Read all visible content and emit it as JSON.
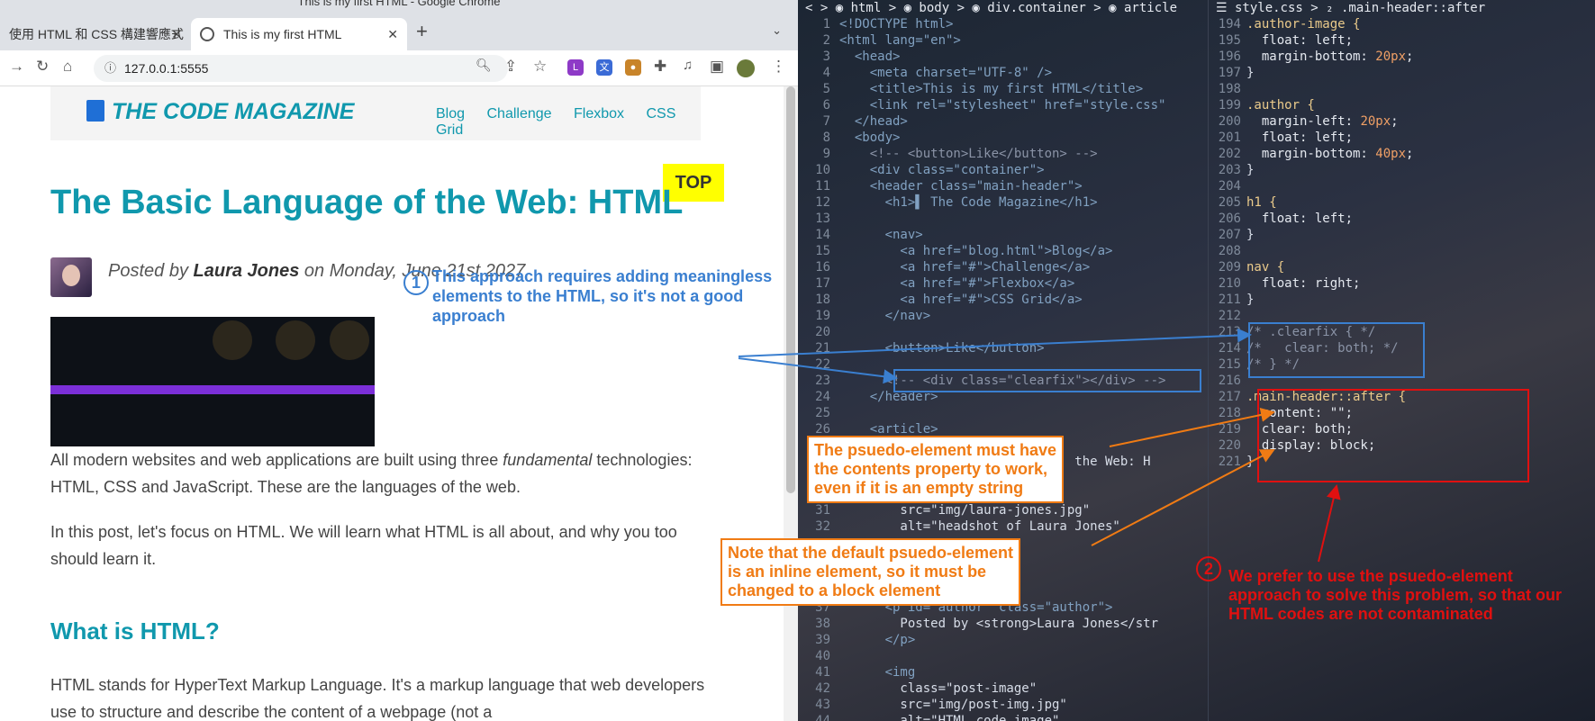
{
  "window_title": "This is my first HTML - Google Chrome",
  "tabs": [
    {
      "label": "使用 HTML 和 CSS 構建響應式"
    },
    {
      "label": "This is my first HTML"
    }
  ],
  "address": "127.0.0.1:5555",
  "page": {
    "logo": "THE CODE MAGAZINE",
    "nav": [
      "Blog",
      "Challenge",
      "Flexbox",
      "CSS Grid"
    ],
    "top_button": "TOP",
    "title": "The Basic Language of the Web: HTML",
    "posted_prefix": "Posted by ",
    "author": "Laura Jones",
    "posted_suffix": " on Monday, June 21st 2027",
    "p1a": "All modern websites and web applications are built using three ",
    "p1b": "fundamental",
    "p1c": " technologies: HTML, CSS and JavaScript. These are the languages of the web.",
    "p2": "In this post, let's focus on HTML. We will learn what HTML is all about, and why you too should learn it.",
    "h2": "What is HTML?",
    "p3": "HTML stands for HyperText Markup Language. It's a markup language that web developers use to structure and describe the content of a webpage (not a"
  },
  "annotations": {
    "n1": "1",
    "n2": "2",
    "blue": "This approach requires adding meaningless elements to the HTML, so it's not a good approach",
    "orange1": [
      "The psuedo-element must have",
      "the contents property to work,",
      "even if it is an empty string"
    ],
    "orange2": [
      "Note that the default psuedo-element",
      "is an inline element, so it must be",
      "changed to a block element"
    ],
    "red": "We prefer to use the psuedo-element approach to solve this problem, so that our HTML codes are not contaminated"
  },
  "editor": {
    "left_crumb": "< > ◉ html > ◉ body > ◉ div.container > ◉ article",
    "right_crumb": "☰ style.css > ₂ .main-header::after",
    "left_lines": [
      {
        "n": "1",
        "t": "<!DOCTYPE html>"
      },
      {
        "n": "2",
        "t": "<html lang=\"en\">"
      },
      {
        "n": "3",
        "t": "  <head>"
      },
      {
        "n": "4",
        "t": "    <meta charset=\"UTF-8\" />"
      },
      {
        "n": "5",
        "t": "    <title>This is my first HTML</title>"
      },
      {
        "n": "6",
        "t": "    <link rel=\"stylesheet\" href=\"style.css\""
      },
      {
        "n": "7",
        "t": "  </head>"
      },
      {
        "n": "8",
        "t": "  <body>"
      },
      {
        "n": "9",
        "t": "    <!-- <button>Like</button> -->"
      },
      {
        "n": "10",
        "t": "    <div class=\"container\">"
      },
      {
        "n": "11",
        "t": "    <header class=\"main-header\">"
      },
      {
        "n": "12",
        "t": "      <h1>▌ The Code Magazine</h1>"
      },
      {
        "n": "13",
        "t": ""
      },
      {
        "n": "14",
        "t": "      <nav>"
      },
      {
        "n": "15",
        "t": "        <a href=\"blog.html\">Blog</a>"
      },
      {
        "n": "16",
        "t": "        <a href=\"#\">Challenge</a>"
      },
      {
        "n": "17",
        "t": "        <a href=\"#\">Flexbox</a>"
      },
      {
        "n": "18",
        "t": "        <a href=\"#\">CSS Grid</a>"
      },
      {
        "n": "19",
        "t": "      </nav>"
      },
      {
        "n": "20",
        "t": ""
      },
      {
        "n": "21",
        "t": "      <button>Like</button>"
      },
      {
        "n": "22",
        "t": ""
      },
      {
        "n": "23",
        "t": "      <!-- <div class=\"clearfix\"></div> -->"
      },
      {
        "n": "24",
        "t": "    </header>"
      },
      {
        "n": "25",
        "t": ""
      },
      {
        "n": "26",
        "t": "    <article>"
      },
      {
        "n": "",
        "t": ""
      },
      {
        "n": "",
        "t": "                               the Web: H"
      },
      {
        "n": "",
        "t": ""
      },
      {
        "n": "",
        "t": ""
      },
      {
        "n": "31",
        "t": "        src=\"img/laura-jones.jpg\""
      },
      {
        "n": "32",
        "t": "        alt=\"headshot of Laura Jones\""
      },
      {
        "n": "",
        "t": ""
      },
      {
        "n": "",
        "t": ""
      },
      {
        "n": "",
        "t": ""
      },
      {
        "n": "",
        "t": ""
      },
      {
        "n": "37",
        "t": "      <p id=\"author\" class=\"author\">"
      },
      {
        "n": "38",
        "t": "        Posted by <strong>Laura Jones</str"
      },
      {
        "n": "39",
        "t": "      </p>"
      },
      {
        "n": "40",
        "t": ""
      },
      {
        "n": "41",
        "t": "      <img"
      },
      {
        "n": "42",
        "t": "        class=\"post-image\""
      },
      {
        "n": "43",
        "t": "        src=\"img/post-img.jpg\""
      },
      {
        "n": "44",
        "t": "        alt=\"HTML code image\""
      }
    ],
    "right_lines": [
      {
        "n": "194",
        "t": ".author-image {"
      },
      {
        "n": "195",
        "t": "  float: left;"
      },
      {
        "n": "196",
        "t": "  margin-bottom: 20px;"
      },
      {
        "n": "197",
        "t": "}"
      },
      {
        "n": "198",
        "t": ""
      },
      {
        "n": "199",
        "t": ".author {"
      },
      {
        "n": "200",
        "t": "  margin-left: 20px;"
      },
      {
        "n": "201",
        "t": "  float: left;"
      },
      {
        "n": "202",
        "t": "  margin-bottom: 40px;"
      },
      {
        "n": "203",
        "t": "}"
      },
      {
        "n": "204",
        "t": ""
      },
      {
        "n": "205",
        "t": "h1 {"
      },
      {
        "n": "206",
        "t": "  float: left;"
      },
      {
        "n": "207",
        "t": "}"
      },
      {
        "n": "208",
        "t": ""
      },
      {
        "n": "209",
        "t": "nav {"
      },
      {
        "n": "210",
        "t": "  float: right;"
      },
      {
        "n": "211",
        "t": "}"
      },
      {
        "n": "212",
        "t": ""
      },
      {
        "n": "213",
        "t": "/* .clearfix { */"
      },
      {
        "n": "214",
        "t": "/*   clear: both; */"
      },
      {
        "n": "215",
        "t": "/* } */"
      },
      {
        "n": "216",
        "t": ""
      },
      {
        "n": "217",
        "t": ".main-header::after {"
      },
      {
        "n": "218",
        "t": "  content: \"\";"
      },
      {
        "n": "219",
        "t": "  clear: both;"
      },
      {
        "n": "220",
        "t": "  display: block;"
      },
      {
        "n": "221",
        "t": "}"
      }
    ]
  }
}
